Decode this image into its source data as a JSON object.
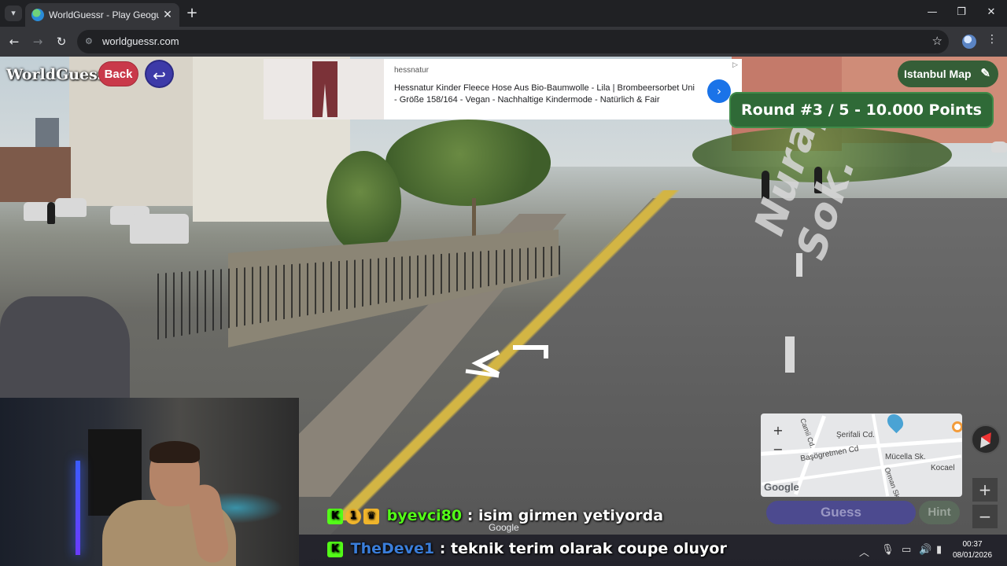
{
  "browser": {
    "tab_title": "WorldGuessr - Play Geoguessr Free",
    "url": "worldguessr.com"
  },
  "game": {
    "logo": "WorldGuessr",
    "back_label": "Back",
    "map_label": "Istanbul Map",
    "round_banner": "Round #3 / 5 - 10.000 Points",
    "guess_label": "Guess",
    "hint_label": "Hint",
    "street_name": "Nuray Sok."
  },
  "ad": {
    "source": "hessnatur",
    "text": "Hessnatur Kinder Fleece Hose Aus Bio-Baumwolle - Lila | Brombeersorbet Uni - Größe 158/164 - Vegan - Nachhaltige Kindermode - Natürlich & Fair"
  },
  "minimap": {
    "labels": [
      "Şerifali Cd.",
      "Başögretmen Cd",
      "Mücella Sk.",
      "Kocael",
      "Camii Cd.",
      "Orman Sk."
    ],
    "zoom_in": "+",
    "zoom_out": "−",
    "attribution": "Google"
  },
  "streetview": {
    "attribution": "Google"
  },
  "chat": [
    {
      "user": "byevci80",
      "message": ": isim girmen yetiyorda"
    },
    {
      "user": "TheDeve1",
      "message": ": teknik terim olarak coupe oluyor"
    }
  ],
  "taskbar": {
    "time": "00:37",
    "date": "08/01/2026"
  },
  "colors": {
    "back_button": "#c9394a",
    "undo_button": "#3d3aa8",
    "round_banner": "#2f6a37",
    "guess_button": "#4c4a8f",
    "kick_green": "#53fc18"
  }
}
